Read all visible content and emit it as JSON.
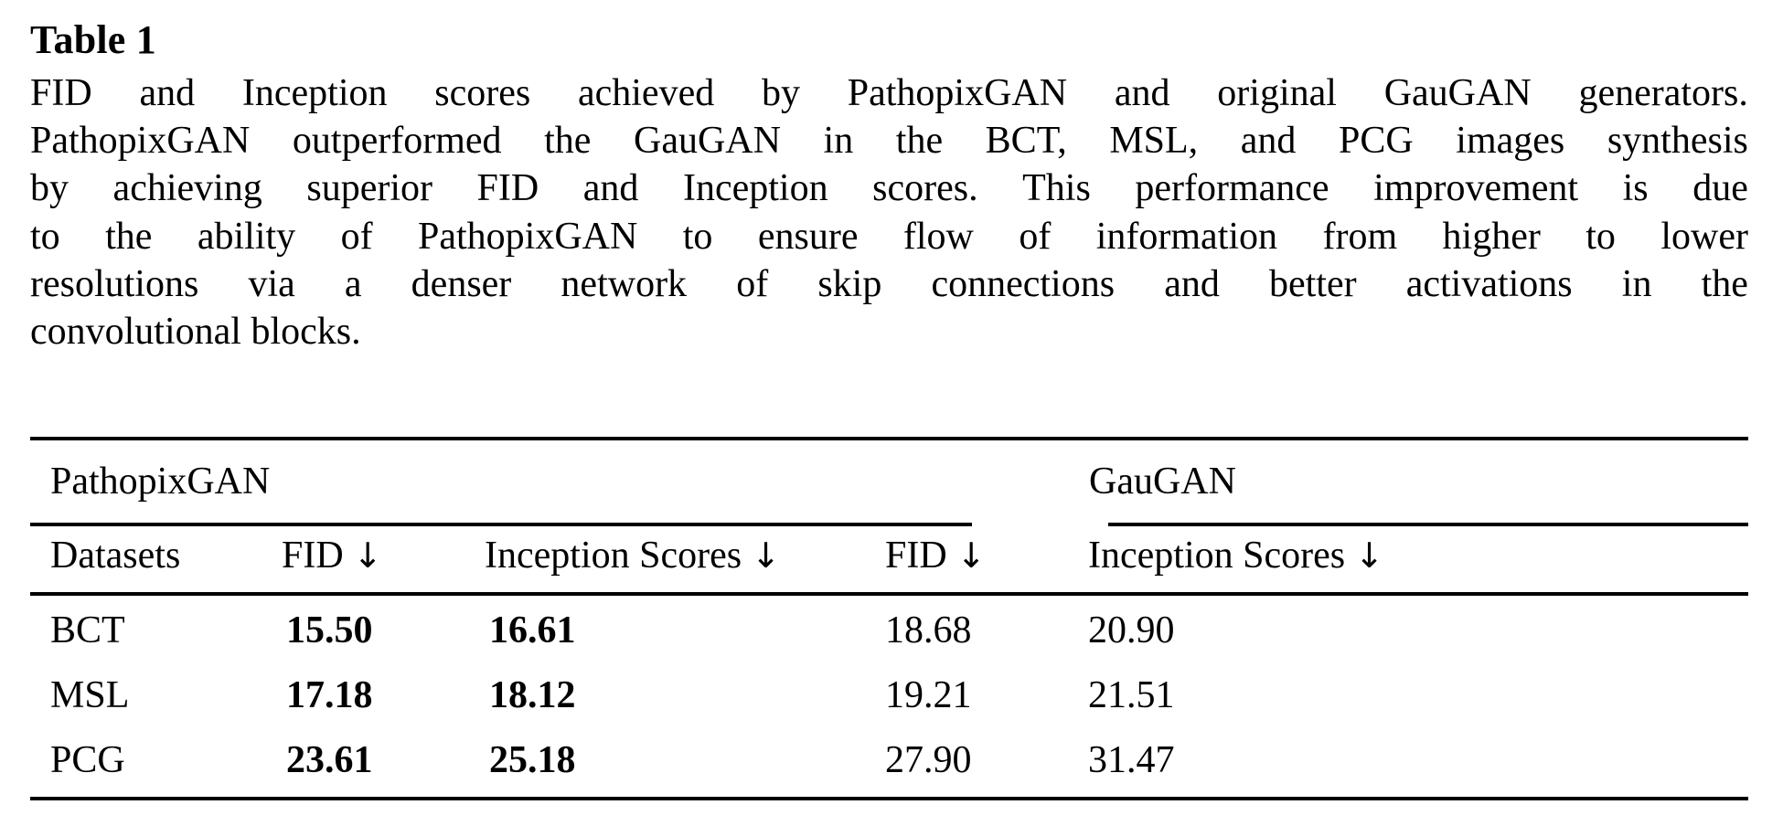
{
  "caption": {
    "title": "Table 1",
    "lines": [
      [
        "FID",
        "and",
        "Inception",
        "scores",
        "achieved",
        "by",
        "PathopixGAN",
        "and",
        "original",
        "GauGAN",
        "generators."
      ],
      [
        "PathopixGAN",
        "outperformed",
        "the",
        "GauGAN",
        "in",
        "the",
        "BCT,",
        "MSL,",
        "and",
        "PCG",
        "images",
        "synthesis"
      ],
      [
        "by",
        "achieving",
        "superior",
        "FID",
        "and",
        "Inception",
        "scores.",
        "This",
        "performance",
        "improvement",
        "is",
        "due"
      ],
      [
        "to",
        "the",
        "ability",
        "of",
        "PathopixGAN",
        "to",
        "ensure",
        "flow",
        "of",
        "information",
        "from",
        "higher",
        "to",
        "lower"
      ],
      [
        "resolutions",
        "via",
        "a",
        "denser",
        "network",
        "of",
        "skip",
        "connections",
        "and",
        "better",
        "activations",
        "in",
        "the"
      ],
      [
        "convolutional blocks."
      ]
    ],
    "full_text": "FID and Inception scores achieved by PathopixGAN and original GauGAN generators. PathopixGAN outperformed the GauGAN in the BCT, MSL, and PCG images synthesis by achieving superior FID and Inception scores. This performance improvement is due to the ability of PathopixGAN to ensure flow of information from higher to lower resolutions via a denser network of skip connections and better activations in the convolutional blocks."
  },
  "table": {
    "groups": {
      "left": "PathopixGAN",
      "right": "GauGAN"
    },
    "headers": {
      "dataset": "Datasets",
      "fid_left": "FID",
      "is_left": "Inception Scores",
      "fid_right": "FID",
      "is_right": "Inception Scores",
      "arrow": "↓"
    },
    "rows": [
      {
        "dataset": "BCT",
        "fid_pathopix": "15.50",
        "is_pathopix": "16.61",
        "fid_gaugan": "18.68",
        "is_gaugan": "20.90"
      },
      {
        "dataset": "MSL",
        "fid_pathopix": "17.18",
        "is_pathopix": "18.12",
        "fid_gaugan": "19.21",
        "is_gaugan": "21.51"
      },
      {
        "dataset": "PCG",
        "fid_pathopix": "23.61",
        "is_pathopix": "25.18",
        "fid_gaugan": "27.90",
        "is_gaugan": "31.47"
      }
    ]
  },
  "chart_data": {
    "type": "table",
    "title": "Table 1",
    "columns": [
      "Datasets",
      "PathopixGAN FID ↓",
      "PathopixGAN Inception Scores ↓",
      "GauGAN FID ↓",
      "GauGAN Inception Scores ↓"
    ],
    "categories": [
      "BCT",
      "MSL",
      "PCG"
    ],
    "series": [
      {
        "name": "PathopixGAN FID",
        "values": [
          15.5,
          17.18,
          23.61
        ]
      },
      {
        "name": "PathopixGAN Inception Scores",
        "values": [
          16.61,
          18.12,
          25.18
        ]
      },
      {
        "name": "GauGAN FID",
        "values": [
          18.68,
          19.21,
          27.9
        ]
      },
      {
        "name": "GauGAN Inception Scores",
        "values": [
          20.9,
          21.51,
          31.47
        ]
      }
    ]
  },
  "colors": {
    "text": "#000000",
    "background": "#ffffff",
    "rule": "#000000"
  }
}
